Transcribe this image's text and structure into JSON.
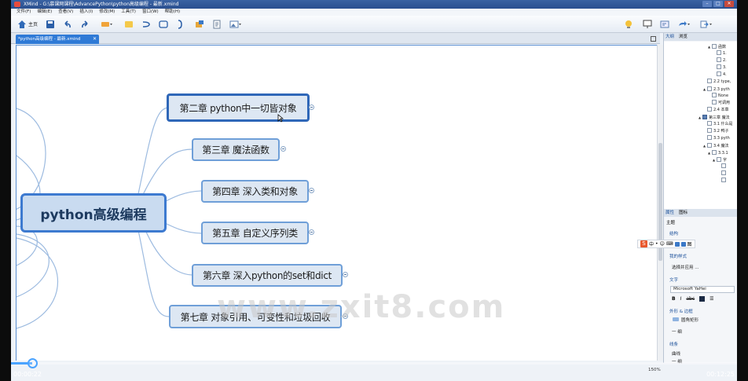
{
  "app": {
    "title": "XMind - G:\\慕课网课程\\AdvancePython\\python高级编程 - 最新.xmind",
    "window_controls": [
      "–",
      "□",
      "✕"
    ]
  },
  "menu": [
    "文件(F)",
    "编辑(E)",
    "查看(V)",
    "插入(I)",
    "修改(M)",
    "工具(T)",
    "窗口(W)",
    "帮助(H)"
  ],
  "toolbar": {
    "home_label": "主页"
  },
  "tab": {
    "label": "*python高级编程 - 最新.xmind",
    "close": "✕"
  },
  "mindmap": {
    "central": "python高级编程",
    "topics": [
      "第二章 python中一切皆对象",
      "第三章 魔法函数",
      "第四章 深入类和对象",
      "第五章 自定义序列类",
      "第六章 深入python的set和dict",
      "第七章 对象引用、可变性和垃圾回收"
    ],
    "selected_index": 0
  },
  "watermark": "www.zxit8.com",
  "right_panel": {
    "top_tabs": [
      "大纲",
      "浏览"
    ],
    "outline": [
      {
        "indent": 3,
        "tri": "▲",
        "text": "函数",
        "icon": "topic"
      },
      {
        "indent": 4,
        "tri": "",
        "text": "1.",
        "icon": "topic"
      },
      {
        "indent": 4,
        "tri": "",
        "text": "2.",
        "icon": "topic"
      },
      {
        "indent": 4,
        "tri": "",
        "text": "3.",
        "icon": "topic"
      },
      {
        "indent": 4,
        "tri": "",
        "text": "4.",
        "icon": "topic"
      },
      {
        "indent": 2,
        "tri": "",
        "text": "2.2 type,",
        "icon": "topic"
      },
      {
        "indent": 2,
        "tri": "▲",
        "text": "2.3 pyth",
        "icon": "topic"
      },
      {
        "indent": 3,
        "tri": "",
        "text": "None",
        "icon": "topic"
      },
      {
        "indent": 3,
        "tri": "",
        "text": "可调用",
        "icon": "topic"
      },
      {
        "indent": 2,
        "tri": "",
        "text": "2.4 本章",
        "icon": "topic"
      },
      {
        "indent": 1,
        "tri": "▲",
        "text": "第三章 魔法",
        "icon": "blue"
      },
      {
        "indent": 2,
        "tri": "",
        "text": "3.1 什么是",
        "icon": "topic"
      },
      {
        "indent": 2,
        "tri": "",
        "text": "3.2 鸭子",
        "icon": "topic"
      },
      {
        "indent": 2,
        "tri": "",
        "text": "3.3 pyth",
        "icon": "topic"
      },
      {
        "indent": 2,
        "tri": "▲",
        "text": "3.4 魔法",
        "icon": "topic"
      },
      {
        "indent": 3,
        "tri": "▲",
        "text": "3.3.1",
        "icon": "topic"
      },
      {
        "indent": 4,
        "tri": "▲",
        "text": "字",
        "icon": "topic"
      },
      {
        "indent": 5,
        "tri": "",
        "text": "",
        "icon": "topic"
      },
      {
        "indent": 5,
        "tri": "",
        "text": "",
        "icon": "topic"
      },
      {
        "indent": 5,
        "tri": "",
        "text": "",
        "icon": "topic"
      }
    ],
    "prop_tabs": [
      "属性",
      "图标"
    ],
    "prop_header": "主题",
    "sections": {
      "structure": "结构",
      "topic_style": "我的样式",
      "style_value": "选择并应用 ...",
      "text": "文字",
      "font": "Microsoft YaHei",
      "shape_border": "外形 & 边框",
      "shape_value": "圆角矩形",
      "line_value": "一 细",
      "lines": "线条",
      "line_style_1": "曲线",
      "line_style_2": "一 细"
    }
  },
  "ime": {
    "items": [
      "中",
      "•",
      "☺",
      "⌨"
    ]
  },
  "status": {
    "zoom": "150%"
  },
  "video": {
    "current": "00:00:22",
    "total": "00:12:25",
    "progress": 0.029
  }
}
